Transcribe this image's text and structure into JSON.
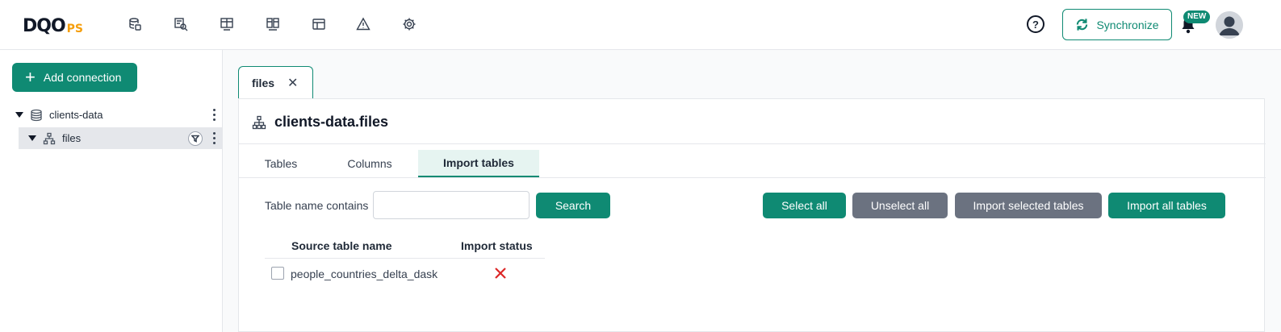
{
  "brand": {
    "logo_main": "DQO",
    "logo_suffix": "PS",
    "accent": "#0f8a73",
    "suffix_color": "#f59e0b"
  },
  "nav_icons": [
    "data-sources-icon",
    "data-profiling-icon",
    "monitoring-checks-icon",
    "partition-checks-icon",
    "data-quality-dashboards-icon",
    "incidents-icon",
    "configuration-icon"
  ],
  "header": {
    "help_label": "?",
    "sync_label": "Synchronize",
    "notification_badge": "NEW"
  },
  "sidebar": {
    "add_connection_label": "Add connection",
    "tree": [
      {
        "label": "clients-data",
        "icon": "database-icon",
        "expanded": true
      },
      {
        "label": "files",
        "icon": "schema-icon",
        "expanded": true,
        "selected": true
      }
    ]
  },
  "main": {
    "open_tab": {
      "label": "files",
      "close": "✕"
    },
    "title": "clients-data.files",
    "subtabs": [
      {
        "label": "Tables",
        "active": false
      },
      {
        "label": "Columns",
        "active": false
      },
      {
        "label": "Import tables",
        "active": true
      }
    ],
    "filter": {
      "label": "Table name contains",
      "value": "",
      "placeholder": ""
    },
    "buttons": {
      "search": "Search",
      "select_all": "Select all",
      "unselect_all": "Unselect all",
      "import_selected": "Import selected tables",
      "import_all": "Import all tables"
    },
    "table": {
      "columns": [
        "Source table name",
        "Import status"
      ],
      "rows": [
        {
          "checked": false,
          "name": "people_countries_delta_dask",
          "status": "not-imported-icon"
        }
      ]
    }
  }
}
